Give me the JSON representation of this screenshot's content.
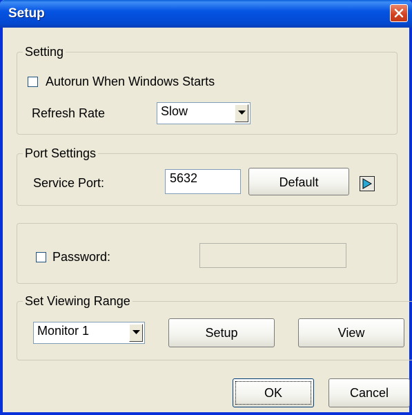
{
  "window": {
    "title": "Setup"
  },
  "setting": {
    "legend": "Setting",
    "autorun_label": "Autorun When Windows Starts",
    "autorun_checked": false,
    "refresh_label": "Refresh Rate",
    "refresh_value": "Slow"
  },
  "port": {
    "legend": "Port Settings",
    "service_label": "Service Port:",
    "service_value": "5632",
    "default_label": "Default"
  },
  "password": {
    "label": "Password:",
    "checked": false,
    "value": ""
  },
  "viewing": {
    "legend": "Set Viewing Range",
    "monitor_value": "Monitor 1",
    "setup_label": "Setup",
    "view_label": "View"
  },
  "footer": {
    "ok_label": "OK",
    "cancel_label": "Cancel"
  },
  "icons": [
    "close-icon",
    "dropdown-arrow-icon",
    "play-icon"
  ]
}
